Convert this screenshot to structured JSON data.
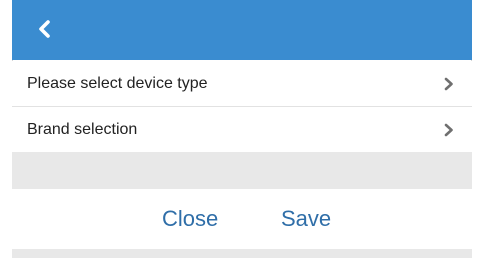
{
  "header": {
    "back_icon": "chevron-left-icon",
    "color": "#3a8cd0"
  },
  "list": {
    "items": [
      {
        "label": "Please select device type",
        "icon": "chevron-right-icon"
      },
      {
        "label": "Brand selection",
        "icon": "chevron-right-icon"
      }
    ]
  },
  "actions": {
    "close_label": "Close",
    "save_label": "Save",
    "color": "#2f6ea8"
  }
}
